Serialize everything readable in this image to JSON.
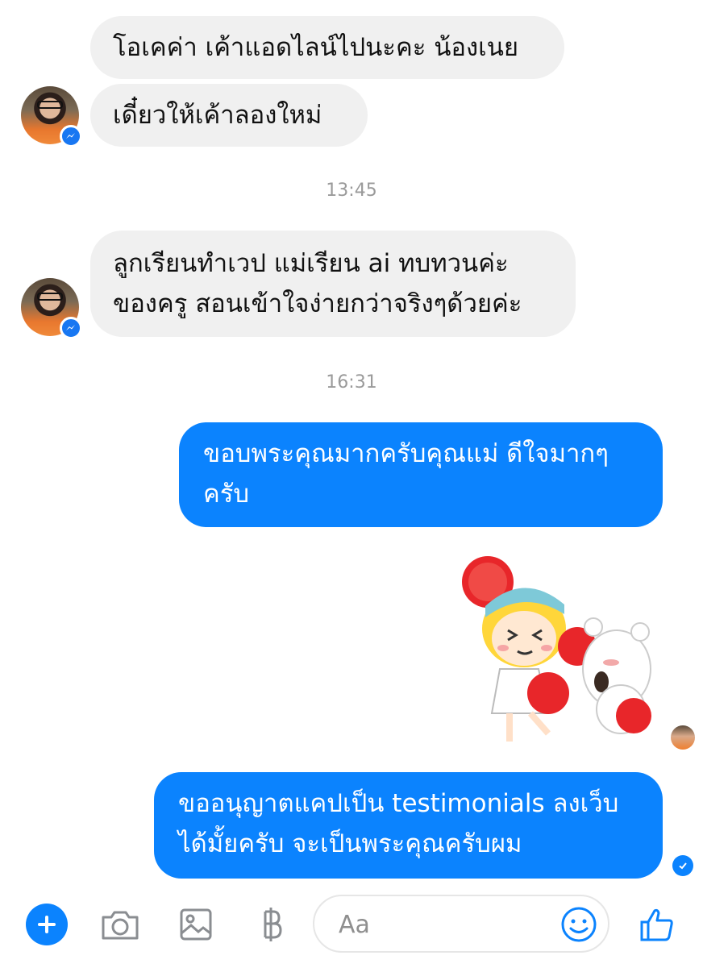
{
  "thread": {
    "incoming_1": {
      "line1": "โอเคค่า เค้าแอดไลน์ไปนะคะ น้องเนย",
      "line2": "เดี๋ยวให้เค้าลองใหม่"
    },
    "timestamp_1": "13:45",
    "incoming_2": {
      "line1": "ลูกเรียนทำเวป แม่เรียน ai ทบทวนค่ะ",
      "line2": "ของครู สอนเข้าใจง่ายกว่าจริงๆด้วยค่ะ"
    },
    "timestamp_2": "16:31",
    "outgoing_1": {
      "line1": "ขอบพระคุณมากครับคุณแม่ ดีใจมากๆ",
      "line2": "ครับ"
    },
    "sticker": "cheerleader-girl-and-bear-sticker",
    "outgoing_2": {
      "line1": "ขออนุญาตแคปเป็น testimonials ลงเว็บ",
      "line2": "ได้มั้ยครับ จะเป็นพระคุณครับผม"
    }
  },
  "composer": {
    "placeholder": "Aa",
    "icons": [
      "plus-icon",
      "camera-icon",
      "image-icon",
      "baht-icon",
      "emoji-icon",
      "like-icon"
    ]
  },
  "colors": {
    "accent": "#0b83fe",
    "incoming_bubble": "#f0f0f0",
    "timestamp": "#9a9a9a"
  }
}
